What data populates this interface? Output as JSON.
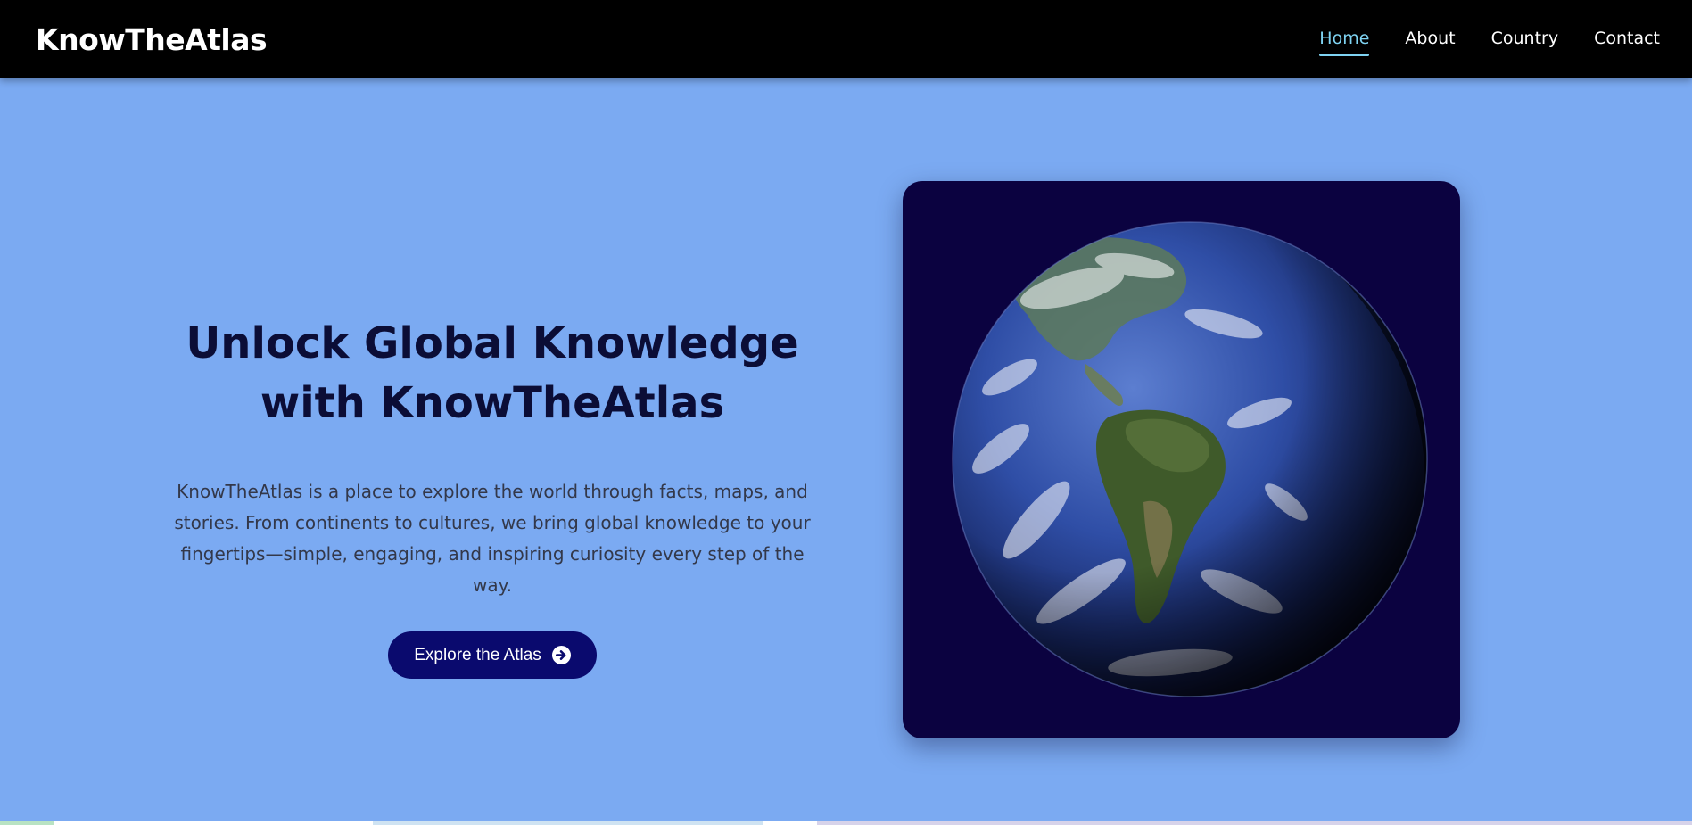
{
  "navbar": {
    "brand": "KnowTheAtlas",
    "links": [
      {
        "label": "Home",
        "active": true
      },
      {
        "label": "About",
        "active": false
      },
      {
        "label": "Country",
        "active": false
      },
      {
        "label": "Contact",
        "active": false
      }
    ]
  },
  "hero": {
    "title_line1": "Unlock Global Knowledge",
    "title_line2": "with KnowTheAtlas",
    "description": "KnowTheAtlas is a place to explore the world through facts, maps, and stories. From continents to cultures, we bring global knowledge to your fingertips—simple, engaging, and inspiring curiosity every step of the way.",
    "cta_label": "Explore the Atlas",
    "cta_icon": "arrow-circle-right-icon"
  },
  "globe_image": {
    "icon": "earth-globe-image"
  },
  "colors": {
    "nav_bg": "#000000",
    "page_bg": "#7baaf2",
    "active_link": "#7fd3f2",
    "title": "#0b0d36",
    "cta_bg": "#0a0a6e",
    "globe_card_bg": "#0b0240"
  }
}
